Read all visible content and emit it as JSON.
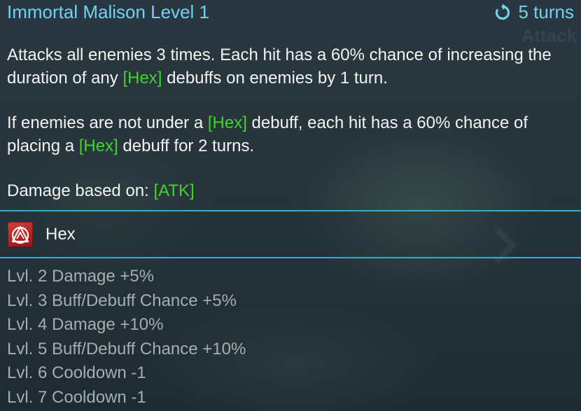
{
  "skill": {
    "title": "Immortal Malison Level 1",
    "cooldown_label": "5 turns",
    "cooldown_icon": "refresh-icon",
    "watermark": "Attack"
  },
  "description": {
    "p1": {
      "a": "Attacks all enemies 3 times. Each hit has a 60% chance of increasing the duration of any ",
      "b": "[Hex]",
      "c": " debuffs on enemies by 1 turn."
    },
    "p2": {
      "a": "If enemies are not under a ",
      "b": "[Hex]",
      "c": " debuff, each hit has a 60% chance of placing a ",
      "d": "[Hex]",
      "e": " debuff for 2 turns."
    },
    "p3": {
      "a": "Damage based on:  ",
      "b": "[ATK]"
    }
  },
  "effect": {
    "icon": "hex-debuff-icon",
    "label": "Hex"
  },
  "levels": [
    "Lvl. 2 Damage +5%",
    "Lvl. 3 Buff/Debuff Chance +5%",
    "Lvl. 4 Damage +10%",
    "Lvl. 5 Buff/Debuff Chance +10%",
    "Lvl. 6 Cooldown -1",
    "Lvl. 7 Cooldown -1"
  ],
  "colors": {
    "title": "#6fd2f2",
    "highlight": "#3fd42a",
    "body_text": "#f2f4f2",
    "level_text": "#a6adaf",
    "divider": "#3fa7d2",
    "hex_icon": "#c42a2a"
  }
}
